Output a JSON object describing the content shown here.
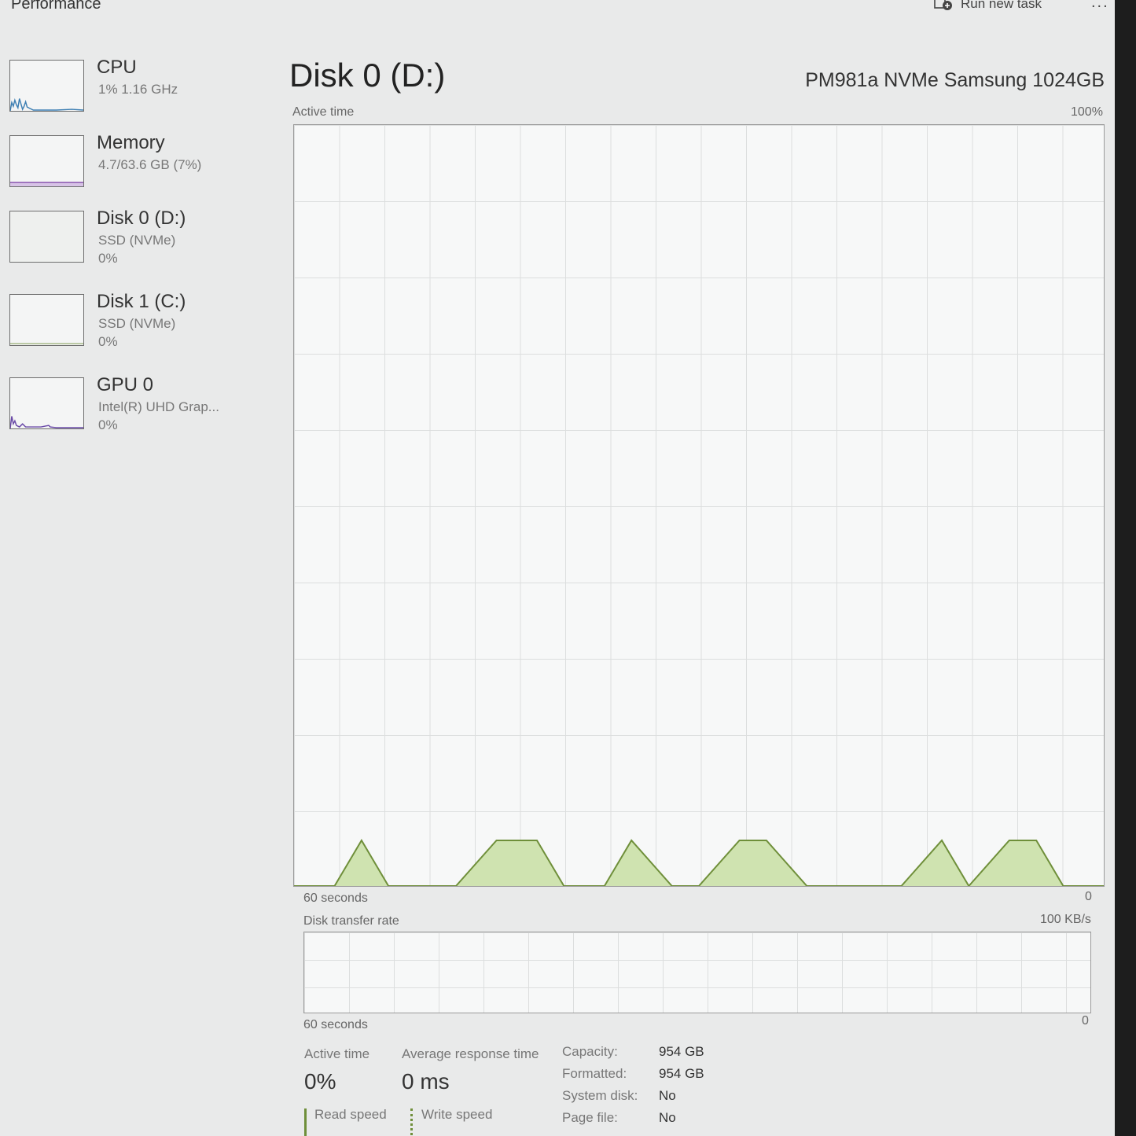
{
  "header": {
    "title": "Performance",
    "run_task_label": "Run new task",
    "more_label": "..."
  },
  "sidebar": {
    "items": [
      {
        "title": "CPU",
        "sub": "1% 1.16 GHz",
        "sub2": ""
      },
      {
        "title": "Memory",
        "sub": "4.7/63.6 GB (7%)",
        "sub2": ""
      },
      {
        "title": "Disk 0 (D:)",
        "sub": "SSD (NVMe)",
        "sub2": "0%"
      },
      {
        "title": "Disk 1 (C:)",
        "sub": "SSD (NVMe)",
        "sub2": "0%"
      },
      {
        "title": "GPU 0",
        "sub": "Intel(R) UHD Grap...",
        "sub2": "0%"
      }
    ]
  },
  "main": {
    "title": "Disk 0 (D:)",
    "model": "PM981a NVMe Samsung 1024GB",
    "active_graph": {
      "label": "Active time",
      "max_label": "100%",
      "time_label": "60 seconds",
      "min_label": "0"
    },
    "transfer_graph": {
      "label": "Disk transfer rate",
      "max_label": "100 KB/s",
      "time_label": "60 seconds",
      "min_label": "0"
    },
    "stats": {
      "active_time_label": "Active time",
      "active_time_value": "0%",
      "avg_response_label": "Average response time",
      "avg_response_value": "0 ms",
      "read_speed_label": "Read speed",
      "write_speed_label": "Write speed"
    },
    "properties": [
      {
        "label": "Capacity:",
        "value": "954 GB"
      },
      {
        "label": "Formatted:",
        "value": "954 GB"
      },
      {
        "label": "System disk:",
        "value": "No"
      },
      {
        "label": "Page file:",
        "value": "No"
      }
    ]
  },
  "colors": {
    "disk_accent": "#6f8f3a",
    "disk_fill": "#cfe3b0",
    "cpu_line": "#3d7fb3",
    "gpu_line": "#6a4aa8"
  },
  "chart_data": {
    "type": "area",
    "label": "Active time",
    "x": [
      60,
      57,
      55,
      53,
      50,
      48,
      45,
      42,
      40,
      37,
      35,
      32,
      30,
      27,
      25,
      22,
      20,
      17,
      15,
      12,
      10,
      7,
      5,
      3,
      0
    ],
    "values": [
      0,
      0,
      1,
      0,
      0,
      0,
      1,
      1,
      0,
      0,
      1,
      0,
      0,
      1,
      1,
      0,
      0,
      0,
      0,
      1,
      0,
      1,
      1,
      0,
      0
    ],
    "ylim": [
      0,
      100
    ],
    "xlim": [
      60,
      0
    ]
  }
}
